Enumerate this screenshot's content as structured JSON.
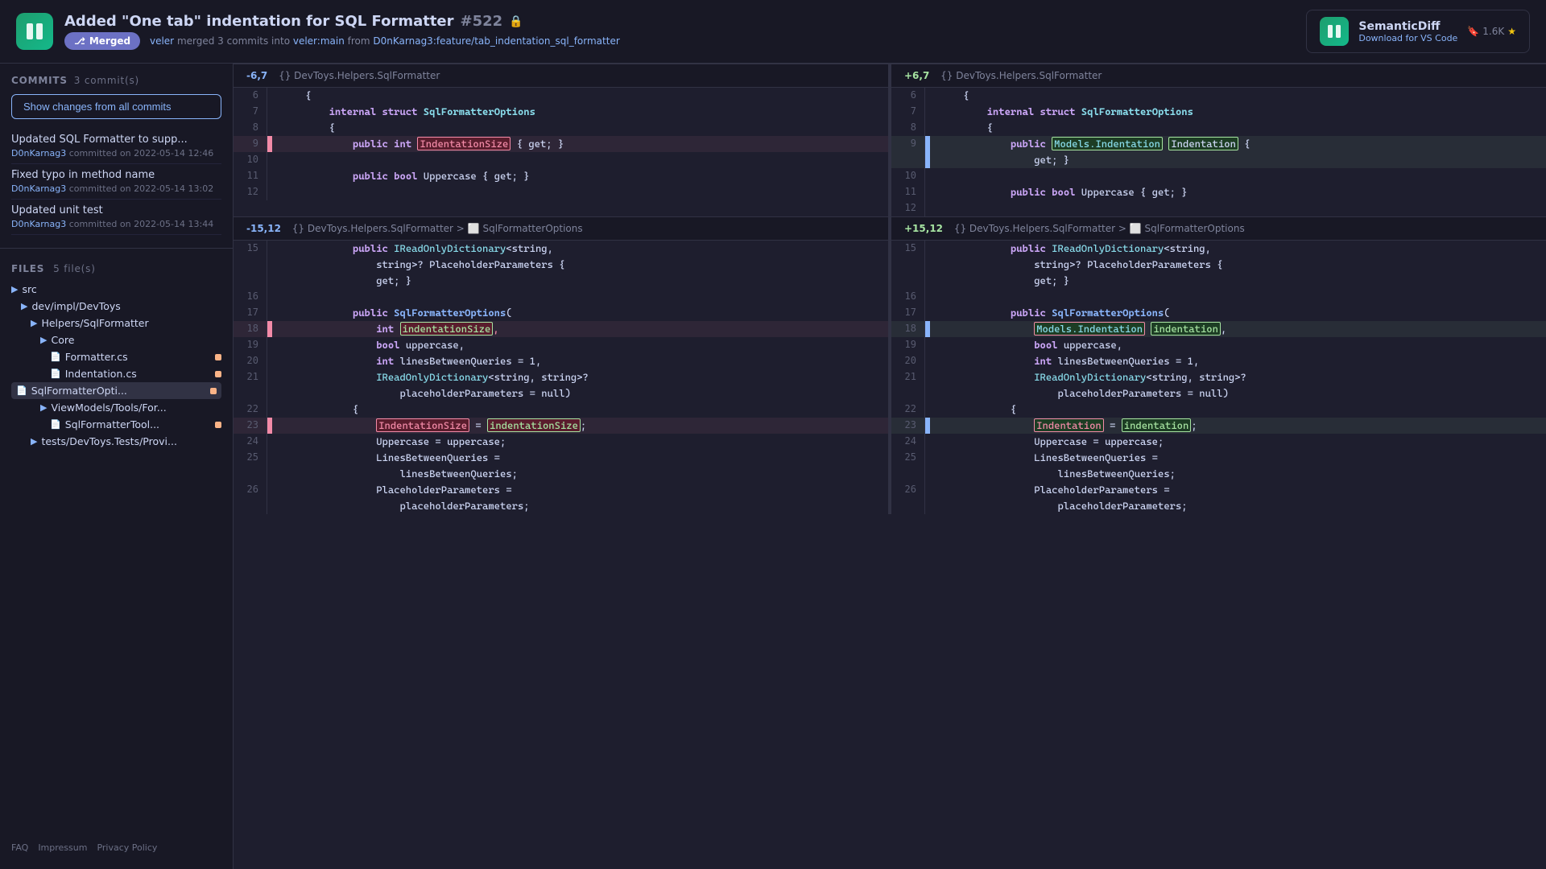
{
  "header": {
    "logo_symbol": "⚙",
    "title": "Added \"One tab\" indentation for SQL Formatter",
    "pr_number": "#522",
    "lock_icon": "🔒",
    "merged_label": "Merged",
    "merge_icon": "⎇",
    "subtitle_author": "veler",
    "subtitle_text": " merged 3 commits into ",
    "subtitle_target": "veler:main",
    "subtitle_from": " from ",
    "subtitle_branch": "D0nKarnag3:feature/tab_indentation_sql_formatter",
    "sd_name": "SemanticDiff",
    "sd_sub": "Download for VS Code",
    "sd_stars": "1.6K",
    "sd_star_icon": "★"
  },
  "sidebar": {
    "commits_label": "COMMITS",
    "commits_count": "3 commit(s)",
    "show_changes_btn": "Show changes from all commits",
    "commits": [
      {
        "message": "Updated SQL Formatter to supp...",
        "author": "D0nKarnag3",
        "date": "committed on 2022-05-14 12:46"
      },
      {
        "message": "Fixed typo in method name",
        "author": "D0nKarnag3",
        "date": "committed on 2022-05-14 13:02"
      },
      {
        "message": "Updated unit test",
        "author": "D0nKarnag3",
        "date": "committed on 2022-05-14 13:44"
      }
    ],
    "files_label": "FILES",
    "files_count": "5 file(s)",
    "tree": [
      {
        "label": "src",
        "type": "folder",
        "indent": 0
      },
      {
        "label": "dev/impl/DevToys",
        "type": "folder",
        "indent": 1
      },
      {
        "label": "Helpers/SqlFormatter",
        "type": "folder",
        "indent": 2
      },
      {
        "label": "Core",
        "type": "folder",
        "indent": 3
      },
      {
        "label": "Formatter.cs",
        "type": "file",
        "indent": 4,
        "changed": true
      },
      {
        "label": "Indentation.cs",
        "type": "file",
        "indent": 4,
        "changed": true
      },
      {
        "label": "SqlFormatterOpti...",
        "type": "file",
        "indent": 4,
        "changed": true,
        "active": true
      },
      {
        "label": "ViewModels/Tools/For...",
        "type": "folder",
        "indent": 3
      },
      {
        "label": "SqlFormatterTool...",
        "type": "file",
        "indent": 4,
        "changed": true
      }
    ],
    "footer_links": [
      "FAQ",
      "Impressum",
      "Privacy Policy"
    ]
  },
  "diff": {
    "hunk1": {
      "left_range": "-6,7",
      "right_range": "+6,7",
      "path": "{} DevToys.Helpers.SqlFormatter",
      "lines_left": [
        {
          "ln": "6",
          "type": "neutral",
          "code": "    {"
        },
        {
          "ln": "7",
          "type": "neutral",
          "code": "        internal struct SqlFormatterOptions"
        },
        {
          "ln": "8",
          "type": "neutral",
          "code": "        {"
        },
        {
          "ln": "9",
          "type": "del",
          "code": "            public int IndentationSize { get; }"
        },
        {
          "ln": "",
          "type": "neutral",
          "code": ""
        },
        {
          "ln": "10",
          "type": "neutral",
          "code": ""
        },
        {
          "ln": "11",
          "type": "neutral",
          "code": "            public bool Uppercase { get; }"
        },
        {
          "ln": "12",
          "type": "neutral",
          "code": ""
        }
      ],
      "lines_right": [
        {
          "ln": "6",
          "type": "neutral",
          "code": "    {"
        },
        {
          "ln": "7",
          "type": "neutral",
          "code": "        internal struct SqlFormatterOptions"
        },
        {
          "ln": "8",
          "type": "neutral",
          "code": "        {"
        },
        {
          "ln": "9",
          "type": "add",
          "code": "            public Models.Indentation Indentation {"
        },
        {
          "ln": "",
          "type": "add",
          "code": "                get; }"
        },
        {
          "ln": "10",
          "type": "neutral",
          "code": ""
        },
        {
          "ln": "11",
          "type": "neutral",
          "code": "            public bool Uppercase { get; }"
        },
        {
          "ln": "12",
          "type": "neutral",
          "code": ""
        }
      ]
    },
    "hunk2": {
      "left_range": "-15,12",
      "right_range": "+15,12",
      "left_path": "{} DevToys.Helpers.SqlFormatter > ⬜ SqlFormatterOptions",
      "right_path": "{} DevToys.Helpers.SqlFormatter > ⬜ SqlFormatterOptions",
      "lines_left": [
        {
          "ln": "15",
          "type": "neutral",
          "code": "            public IReadOnlyDictionary<string,"
        },
        {
          "ln": "",
          "type": "neutral",
          "code": "                string>? PlaceholderParameters {"
        },
        {
          "ln": "",
          "type": "neutral",
          "code": "                get; }"
        },
        {
          "ln": "16",
          "type": "neutral",
          "code": ""
        },
        {
          "ln": "17",
          "type": "neutral",
          "code": "            public SqlFormatterOptions("
        },
        {
          "ln": "18",
          "type": "del",
          "code": "                int indentationSize,"
        },
        {
          "ln": "19",
          "type": "neutral",
          "code": "                bool uppercase,"
        },
        {
          "ln": "20",
          "type": "neutral",
          "code": "                int linesBetweenQueries = 1,"
        },
        {
          "ln": "21",
          "type": "neutral",
          "code": "                IReadOnlyDictionary<string, string>?"
        },
        {
          "ln": "",
          "type": "neutral",
          "code": "                    placeholderParameters = null)"
        },
        {
          "ln": "22",
          "type": "neutral",
          "code": "            {"
        },
        {
          "ln": "23",
          "type": "del",
          "code": "                IndentationSize = indentationSize;"
        },
        {
          "ln": "24",
          "type": "neutral",
          "code": "                Uppercase = uppercase;"
        },
        {
          "ln": "25",
          "type": "neutral",
          "code": "                LinesBetweenQueries ="
        },
        {
          "ln": "",
          "type": "neutral",
          "code": "                    linesBetweenQueries;"
        },
        {
          "ln": "26",
          "type": "neutral",
          "code": "                PlaceholderParameters ="
        },
        {
          "ln": "",
          "type": "neutral",
          "code": "                    placeholderParameters;"
        }
      ],
      "lines_right": [
        {
          "ln": "15",
          "type": "neutral",
          "code": "            public IReadOnlyDictionary<string,"
        },
        {
          "ln": "",
          "type": "neutral",
          "code": "                string>? PlaceholderParameters {"
        },
        {
          "ln": "",
          "type": "neutral",
          "code": "                get; }"
        },
        {
          "ln": "16",
          "type": "neutral",
          "code": ""
        },
        {
          "ln": "17",
          "type": "neutral",
          "code": "            public SqlFormatterOptions("
        },
        {
          "ln": "18",
          "type": "add",
          "code": "                Models.Indentation indentation,"
        },
        {
          "ln": "19",
          "type": "neutral",
          "code": "                bool uppercase,"
        },
        {
          "ln": "20",
          "type": "neutral",
          "code": "                int linesBetweenQueries = 1,"
        },
        {
          "ln": "21",
          "type": "neutral",
          "code": "                IReadOnlyDictionary<string, string>?"
        },
        {
          "ln": "",
          "type": "neutral",
          "code": "                    placeholderParameters = null)"
        },
        {
          "ln": "22",
          "type": "neutral",
          "code": "            {"
        },
        {
          "ln": "23",
          "type": "add",
          "code": "                Indentation = indentation;"
        },
        {
          "ln": "24",
          "type": "neutral",
          "code": "                Uppercase = uppercase;"
        },
        {
          "ln": "25",
          "type": "neutral",
          "code": "                LinesBetweenQueries ="
        },
        {
          "ln": "",
          "type": "neutral",
          "code": "                    linesBetweenQueries;"
        },
        {
          "ln": "26",
          "type": "neutral",
          "code": "                PlaceholderParameters ="
        },
        {
          "ln": "",
          "type": "neutral",
          "code": "                    placeholderParameters;"
        }
      ]
    }
  }
}
